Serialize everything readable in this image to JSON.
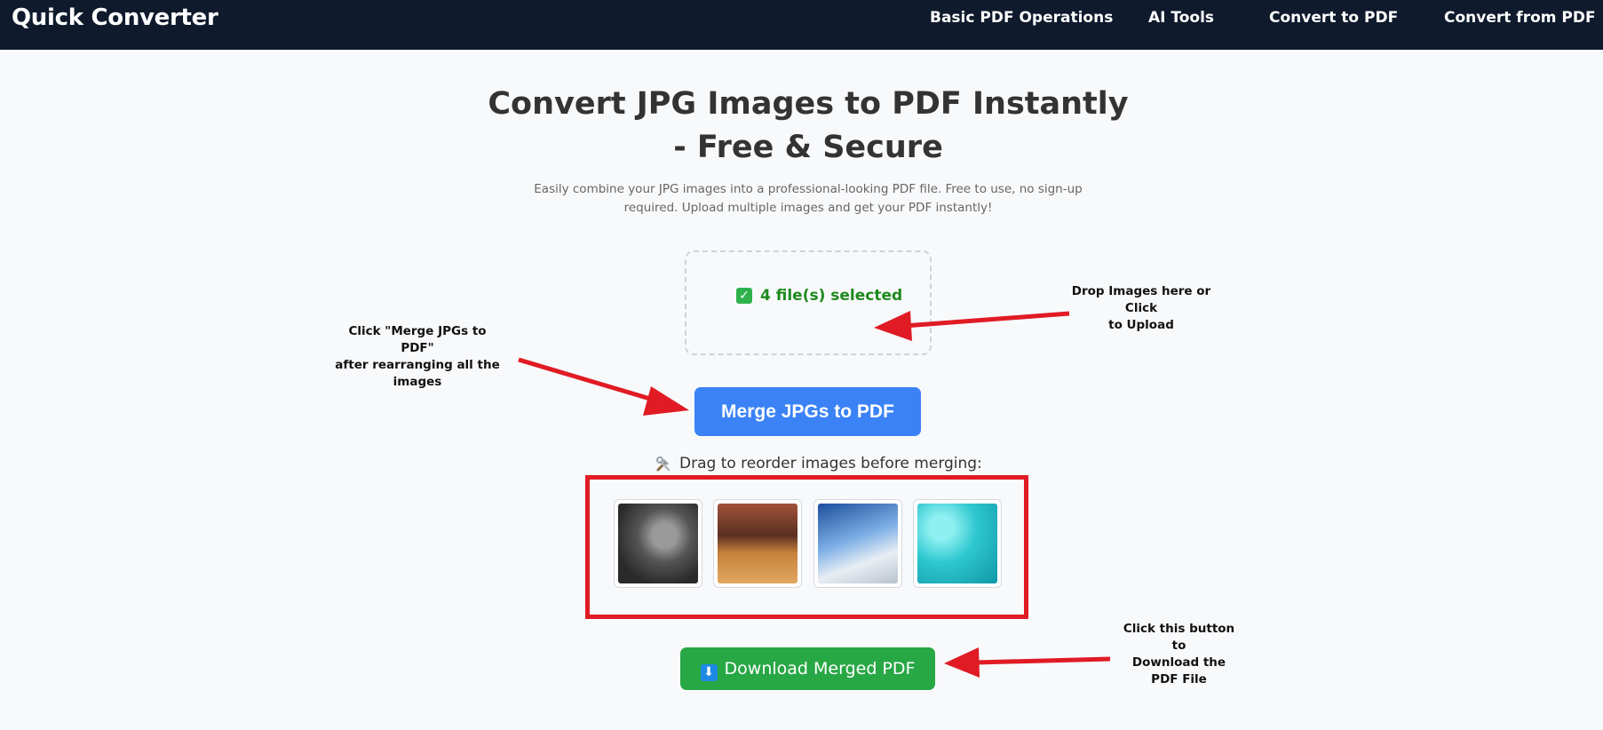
{
  "header": {
    "brand": "Quick Converter",
    "nav": [
      "Basic PDF Operations",
      "AI Tools",
      "Convert to PDF",
      "Convert from PDF"
    ]
  },
  "hero": {
    "title_line1": "Convert JPG Images to PDF Instantly",
    "title_line2": "- Free & Secure",
    "subtitle_line1": "Easily combine your JPG images into a professional-looking PDF file. Free to use, no sign-up",
    "subtitle_line2": "required. Upload multiple images and get your PDF instantly!"
  },
  "upload": {
    "status_text": "4 file(s) selected",
    "check_icon": "check-box-icon"
  },
  "merge_button": "Merge JPGs to PDF",
  "reorder": {
    "hint_text": "Drag to reorder images before merging:",
    "hint_icon": "tools-icon",
    "images": [
      {
        "icon": "portrait-photo"
      },
      {
        "icon": "table-photo"
      },
      {
        "icon": "airplane-wing-photo"
      },
      {
        "icon": "butterflies-photo"
      }
    ]
  },
  "download_button": "Download Merged PDF",
  "annotations": {
    "drop_line1": "Drop Images here or Click",
    "drop_line2": "to Upload",
    "merge_line1": "Click \"Merge JPGs to PDF\"",
    "merge_line2": "after rearranging all the",
    "merge_line3": "images",
    "download_line1": "Click this button to",
    "download_line2": "Download the",
    "download_line3": "PDF File"
  },
  "colors": {
    "header_bg": "#0f1a2c",
    "merge_blue": "#3b82f6",
    "download_green": "#28a745",
    "selected_green": "#1e8a1e",
    "annotation_red": "#e01b24"
  }
}
